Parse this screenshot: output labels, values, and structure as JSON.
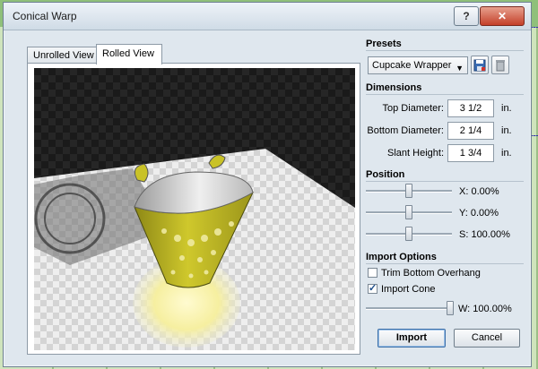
{
  "window": {
    "title": "Conical Warp"
  },
  "tabs": [
    "Unrolled View",
    "Rolled View"
  ],
  "presets": {
    "heading": "Presets",
    "selected": "Cupcake Wrapper"
  },
  "dimensions": {
    "heading": "Dimensions",
    "fields": [
      {
        "label": "Top Diameter:",
        "value": "3 1/2",
        "unit": "in."
      },
      {
        "label": "Bottom Diameter:",
        "value": "2 1/4",
        "unit": "in."
      },
      {
        "label": "Slant Height:",
        "value": "1 3/4",
        "unit": "in."
      }
    ]
  },
  "position": {
    "heading": "Position",
    "sliders": [
      {
        "label": "X: 0.00%",
        "level": 0.5
      },
      {
        "label": "Y: 0.00%",
        "level": 0.5
      },
      {
        "label": "S: 100.00%",
        "level": 0.5
      }
    ]
  },
  "import_options": {
    "heading": "Import Options",
    "trim_label": "Trim Bottom Overhang",
    "trim_checked": false,
    "cone_label": "Import Cone",
    "cone_checked": true,
    "width_label": "W: 100.00%",
    "width_level": 1.0
  },
  "buttons": {
    "import": "Import",
    "cancel": "Cancel"
  },
  "colors": {
    "accent": "#3c6fa8",
    "close": "#c4402a",
    "wrapper": "#c9c227"
  }
}
